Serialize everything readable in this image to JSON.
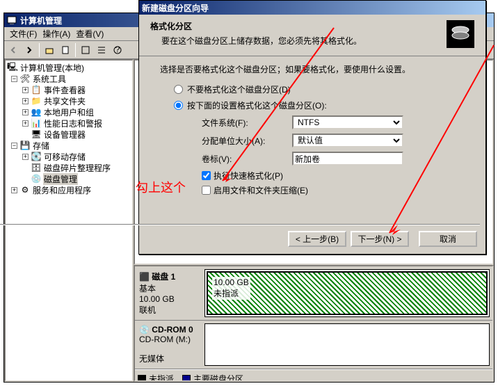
{
  "window": {
    "title": "计算机管理"
  },
  "menu": {
    "file": "文件(F)",
    "action": "操作(A)",
    "view": "查看(V)"
  },
  "tree": {
    "root": "计算机管理(本地)",
    "system_tools": "系统工具",
    "event_viewer": "事件查看器",
    "shared_folders": "共享文件夹",
    "local_users": "本地用户和组",
    "perf_logs": "性能日志和警报",
    "device_mgr": "设备管理器",
    "storage": "存储",
    "removable": "可移动存储",
    "defrag": "磁盘碎片整理程序",
    "diskmgmt": "磁盘管理",
    "services": "服务和应用程序"
  },
  "disks": {
    "disk1": {
      "name": "磁盘 1",
      "type": "基本",
      "size": "10.00 GB",
      "status": "联机",
      "seg_size": "10.00 GB",
      "seg_status": "未指派"
    },
    "cdrom": {
      "name": "CD-ROM 0",
      "label": "CD-ROM (M:)",
      "status": "无媒体"
    }
  },
  "legend": {
    "unalloc": "未指派",
    "primary": "主要磁盘分区"
  },
  "dialog": {
    "title": "新建磁盘分区向导",
    "heading": "格式化分区",
    "subheading": "要在这个磁盘分区上储存数据，您必须先将其格式化。",
    "instruction": "选择是否要格式化这个磁盘分区；如果要格式化，要使用什么设置。",
    "radio_no": "不要格式化这个磁盘分区(D)",
    "radio_yes": "按下面的设置格式化这个磁盘分区(O):",
    "fs_label": "文件系统(F):",
    "fs_value": "NTFS",
    "alloc_label": "分配单位大小(A):",
    "alloc_value": "默认值",
    "vol_label": "卷标(V):",
    "vol_value": "新加卷",
    "chk_quick": "执行快速格式化(P)",
    "chk_compress": "启用文件和文件夹压缩(E)",
    "btn_back": "< 上一步(B)",
    "btn_next": "下一步(N) >",
    "btn_cancel": "取消"
  },
  "annotation": {
    "text": "勾上这个"
  }
}
